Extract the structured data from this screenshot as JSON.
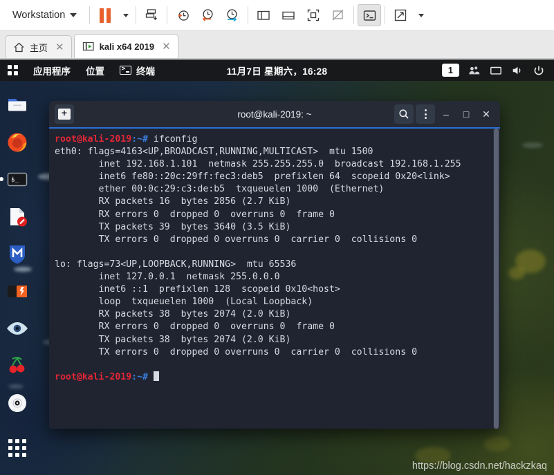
{
  "vmware": {
    "menu_label": "Workstation",
    "toolbar_buttons": [
      {
        "name": "pause-vm-button",
        "icon": "pause-icon"
      },
      {
        "name": "pause-dropdown",
        "icon": "caret-down-icon"
      },
      {
        "name": "snapshot-manager-button",
        "icon": "snapshot-icon"
      },
      {
        "name": "take-snapshot-button",
        "icon": "clock-plus-icon"
      },
      {
        "name": "revert-snapshot-button",
        "icon": "clock-back-icon"
      },
      {
        "name": "manage-snapshots-button",
        "icon": "clock-wrench-icon"
      },
      {
        "name": "show-sidebar-button",
        "icon": "sidebar-panel-icon"
      },
      {
        "name": "show-bottom-panel-button",
        "icon": "bottom-panel-icon"
      },
      {
        "name": "fullscreen-button",
        "icon": "fullscreen-icon"
      },
      {
        "name": "unity-mode-button",
        "icon": "unity-icon"
      },
      {
        "name": "console-view-button",
        "icon": "console-icon"
      },
      {
        "name": "stretch-button",
        "icon": "expand-arrows-icon"
      },
      {
        "name": "stretch-dropdown",
        "icon": "caret-down-icon"
      }
    ]
  },
  "tabs": [
    {
      "label": "主页",
      "icon": "home-icon",
      "close": "✕",
      "active": false
    },
    {
      "label": "kali x64 2019",
      "icon": "vm-play-icon",
      "close": "✕",
      "active": true
    }
  ],
  "gnome_panel": {
    "activities_icon": "apps-grid-icon",
    "applications_label": "应用程序",
    "places_label": "位置",
    "terminal_icon": "terminal-icon",
    "terminal_label": "终端",
    "clock": "11月7日 星期六，16:28",
    "workspace": "1",
    "right_icons": [
      "workspace-switcher-icon",
      "display-icon",
      "volume-icon",
      "power-icon"
    ]
  },
  "dock": {
    "items": [
      {
        "name": "dock-item-files",
        "icon": "files-icon",
        "running": false
      },
      {
        "name": "dock-item-firefox",
        "icon": "firefox-icon",
        "running": false
      },
      {
        "name": "dock-item-terminal",
        "icon": "terminal-icon",
        "running": true
      },
      {
        "name": "dock-item-text-editor",
        "icon": "text-editor-icon",
        "running": false
      },
      {
        "name": "dock-item-metasploit",
        "icon": "metasploit-icon",
        "running": false
      },
      {
        "name": "dock-item-burpsuite",
        "icon": "burpsuite-icon",
        "running": false
      },
      {
        "name": "dock-item-wireshark",
        "icon": "wireshark-icon",
        "running": false
      },
      {
        "name": "dock-item-cherrytree",
        "icon": "cherrytree-icon",
        "running": false
      },
      {
        "name": "dock-item-disc",
        "icon": "disc-icon",
        "running": false
      }
    ],
    "show_apps_icon": "apps-grid-icon"
  },
  "terminal": {
    "title": "root@kali-2019: ~",
    "new_tab_icon": "new-tab-icon",
    "search_icon": "search-icon",
    "menu_icon": "kebab-menu-icon",
    "minimize": "–",
    "maximize": "□",
    "close": "✕",
    "prompt_user": "root@kali-2019",
    "prompt_path": ":~#",
    "command": " ifconfig",
    "lines": [
      "eth0: flags=4163<UP,BROADCAST,RUNNING,MULTICAST>  mtu 1500",
      "        inet 192.168.1.101  netmask 255.255.255.0  broadcast 192.168.1.255",
      "        inet6 fe80::20c:29ff:fec3:deb5  prefixlen 64  scopeid 0x20<link>",
      "        ether 00:0c:29:c3:de:b5  txqueuelen 1000  (Ethernet)",
      "        RX packets 16  bytes 2856 (2.7 KiB)",
      "        RX errors 0  dropped 0  overruns 0  frame 0",
      "        TX packets 39  bytes 3640 (3.5 KiB)",
      "        TX errors 0  dropped 0 overruns 0  carrier 0  collisions 0",
      "",
      "lo: flags=73<UP,LOOPBACK,RUNNING>  mtu 65536",
      "        inet 127.0.0.1  netmask 255.0.0.0",
      "        inet6 ::1  prefixlen 128  scopeid 0x10<host>",
      "        loop  txqueuelen 1000  (Local Loopback)",
      "        RX packets 38  bytes 2074 (2.0 KiB)",
      "        RX errors 0  dropped 0  overruns 0  frame 0",
      "        TX packets 38  bytes 2074 (2.0 KiB)",
      "        TX errors 0  dropped 0 overruns 0  carrier 0  collisions 0",
      ""
    ]
  },
  "watermark": "https://blog.csdn.net/hackzkaq",
  "colors": {
    "accent_orange": "#e8602c",
    "title_accent": "#2b6fd4",
    "terminal_bg": "#1f2430",
    "prompt_red": "#e32636",
    "prompt_blue": "#3b7fe0"
  }
}
